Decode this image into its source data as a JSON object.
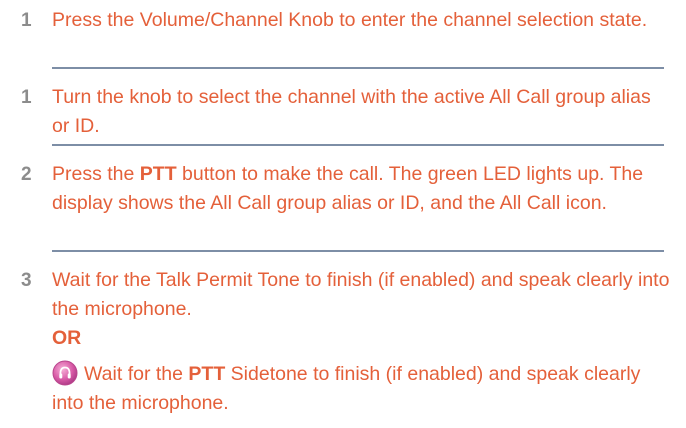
{
  "colors": {
    "text": "#e4603a",
    "step_number": "#8c8c8c",
    "rule": "#7d8ea6",
    "icon_fill": "#d85aa6"
  },
  "steps": [
    {
      "number": "1",
      "text": "Press the Volume/Channel Knob to enter the channel selection state."
    },
    {
      "number": "1",
      "text": "Turn the knob to select the channel with the active All Call group alias or ID."
    },
    {
      "number": "2",
      "text_before": "Press the ",
      "bold": "PTT",
      "text_after": " button to make the call. The green LED lights up. The display shows the All Call group alias or ID, and the All Call icon."
    },
    {
      "number": "3",
      "text": "Wait for the Talk Permit Tone to finish (if enabled) and speak clearly into the microphone.",
      "or_label": "OR",
      "alt_icon": "sidetone-icon",
      "alt_before": "Wait for the ",
      "alt_bold": "PTT",
      "alt_after": " Sidetone to finish (if enabled) and speak clearly into the microphone."
    }
  ]
}
